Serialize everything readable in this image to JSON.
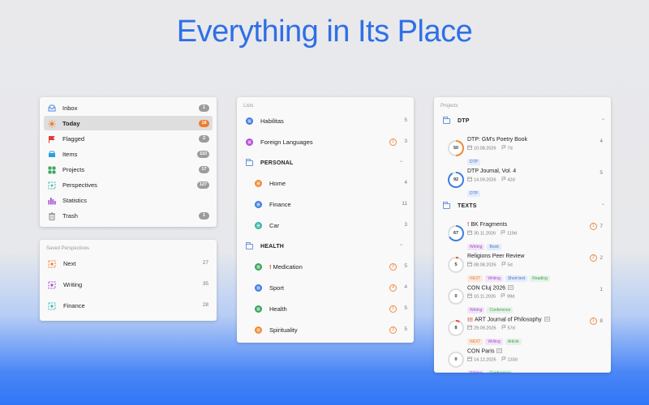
{
  "headline": "Everything in Its Place",
  "nav": {
    "items": [
      {
        "label": "Inbox",
        "count": "1",
        "icon": "inbox-icon",
        "color": "#4a86e8"
      },
      {
        "label": "Today",
        "count": "18",
        "icon": "sun-icon",
        "color": "#f07b2e",
        "selected": true
      },
      {
        "label": "Flagged",
        "count": "2",
        "icon": "flag-icon",
        "color": "#e53935"
      },
      {
        "label": "Items",
        "count": "110",
        "icon": "tray-icon",
        "color": "#2b9fd9"
      },
      {
        "label": "Projects",
        "count": "17",
        "icon": "grid-icon",
        "color": "#3aa55b"
      },
      {
        "label": "Perspectives",
        "count": "127",
        "icon": "perspective-icon",
        "color": "#3bb8b0"
      },
      {
        "label": "Statistics",
        "count": "",
        "icon": "bar-chart-icon",
        "color": "#9b45d0"
      },
      {
        "label": "Trash",
        "count": "1",
        "icon": "trash-icon",
        "color": "#888888"
      }
    ]
  },
  "saved": {
    "heading": "Saved Perspectives",
    "items": [
      {
        "label": "Next",
        "count": "27",
        "color": "#f07b2e"
      },
      {
        "label": "Writing",
        "count": "35",
        "color": "#b049d6"
      },
      {
        "label": "Finance",
        "count": "28",
        "color": "#3bb8b0"
      }
    ]
  },
  "lists": {
    "heading": "Lists",
    "items": [
      {
        "label": "Habilitas",
        "count": "5",
        "color": "#3d7de0"
      },
      {
        "label": "Foreign Languages",
        "badge": "1",
        "count": "3",
        "color": "#b049d6"
      }
    ],
    "groups": [
      {
        "label": "PERSONAL",
        "items": [
          {
            "label": "Home",
            "count": "4",
            "color": "#f08a30"
          },
          {
            "label": "Finance",
            "count": "11",
            "color": "#3d7de0"
          },
          {
            "label": "Car",
            "count": "3",
            "color": "#33b3a5"
          }
        ]
      },
      {
        "label": "HEALTH",
        "items": [
          {
            "label": "Medication",
            "prefix": "!",
            "badge": "3",
            "count": "5",
            "color": "#3aa55b"
          },
          {
            "label": "Sport",
            "badge": "4",
            "count": "4",
            "color": "#3d7de0"
          },
          {
            "label": "Health",
            "badge": "1",
            "count": "5",
            "color": "#3aa55b"
          },
          {
            "label": "Spirituality",
            "badge": "3",
            "count": "5",
            "color": "#f08a30"
          }
        ]
      }
    ]
  },
  "projects": {
    "heading": "Projects",
    "groups": [
      {
        "label": "DTP",
        "items": [
          {
            "percent": "50",
            "title": "DTP: GM's Poetry Book",
            "date": "10.08.2026",
            "days": "7d",
            "tags": [
              {
                "t": "DTP",
                "c": "blue"
              }
            ],
            "count": "4",
            "ring": "#f08a30"
          },
          {
            "percent": "92",
            "title": "DTP Journal, Vol. 4",
            "date": "14.09.2026",
            "days": "42d",
            "tags": [
              {
                "t": "DTP",
                "c": "blue"
              }
            ],
            "count": "5",
            "ring": "#3d7de0"
          }
        ]
      },
      {
        "label": "TEXTS",
        "items": [
          {
            "percent": "67",
            "prefix": "!",
            "title": "BK Fragments",
            "date": "30.11.2026",
            "days": "119d",
            "tags": [
              {
                "t": "Writing",
                "c": "pur"
              },
              {
                "t": "Book",
                "c": "blue"
              }
            ],
            "badge": "1",
            "count": "7",
            "ring": "#3d7de0"
          },
          {
            "percent": "5",
            "title": "Religions Peer Review",
            "date": "08.08.2026",
            "days": "5d",
            "tags": [
              {
                "t": "NEXT",
                "c": "org"
              },
              {
                "t": "Writing",
                "c": "pur"
              },
              {
                "t": "Short text",
                "c": "blue"
              },
              {
                "t": "Reading",
                "c": "grn"
              }
            ],
            "badge": "2",
            "count": "2",
            "ring": "#e5462f"
          },
          {
            "percent": "0",
            "title": "CON Cluj 2026",
            "date": "10.11.2026",
            "days": "99d",
            "tags": [
              {
                "t": "Writing",
                "c": "pur"
              },
              {
                "t": "Conference",
                "c": "grn"
              }
            ],
            "count": "1",
            "ring": "#dddddd",
            "note": true
          },
          {
            "percent": "8",
            "prefix": "!!!",
            "title": "ART Journal of Philosophy",
            "date": "29.09.2026",
            "days": "57d",
            "tags": [
              {
                "t": "NEXT",
                "c": "org"
              },
              {
                "t": "Writing",
                "c": "pur"
              },
              {
                "t": "Article",
                "c": "grn"
              }
            ],
            "badge": "1",
            "count": "8",
            "ring": "#e5462f",
            "note": true
          },
          {
            "percent": "0",
            "title": "CON Paris",
            "date": "14.12.2026",
            "days": "133d",
            "tags": [
              {
                "t": "Writing",
                "c": "pur"
              },
              {
                "t": "Conference",
                "c": "grn"
              }
            ],
            "count": "",
            "ring": "#dddddd",
            "note": true
          }
        ]
      }
    ]
  }
}
